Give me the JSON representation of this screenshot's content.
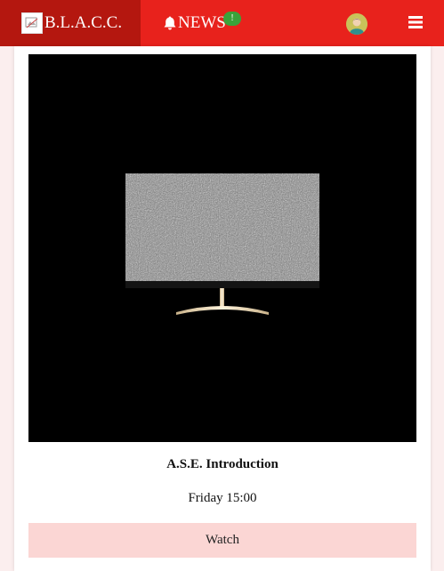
{
  "navbar": {
    "brand_label": "B.L.A.C.C.",
    "news_label": "NEWS",
    "news_badge": "!",
    "bg_color": "#e8221c",
    "brand_bg_color": "#b4170f"
  },
  "icons": {
    "brand": "broken-image-icon",
    "news": "bell-icon",
    "avatar": "user-avatar-icon",
    "menu": "hamburger-menu-icon"
  },
  "video_card": {
    "title": "A.S.E. Introduction",
    "time": "Friday 15:00",
    "watch_label": "Watch",
    "thumbnail": "tv-static-icon"
  }
}
